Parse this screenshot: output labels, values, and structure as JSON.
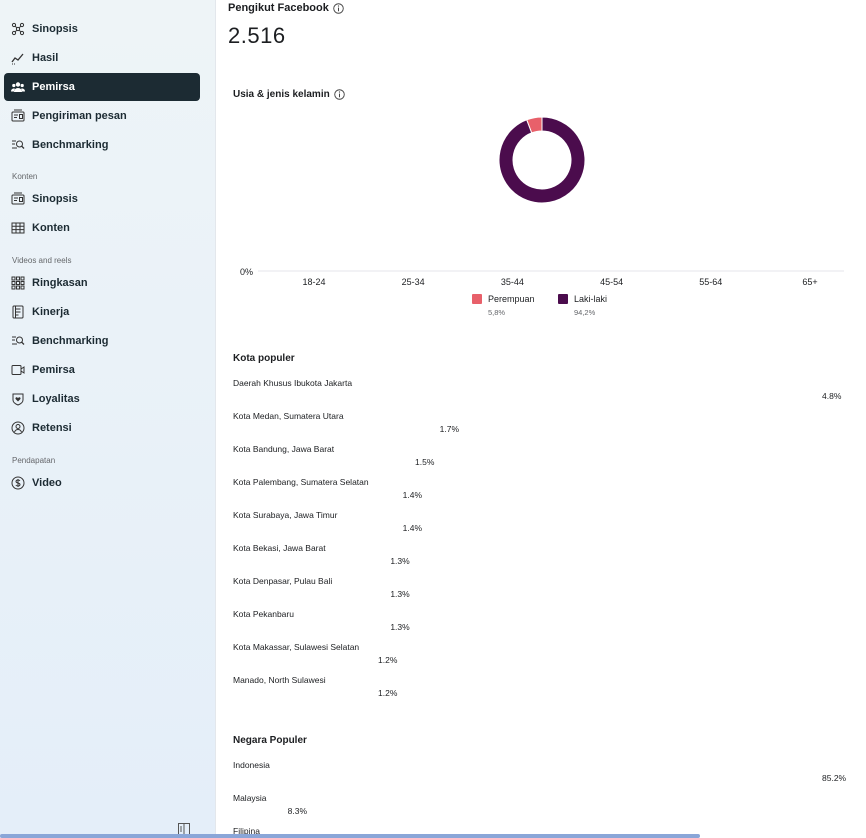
{
  "sidebar": {
    "items_top": [
      {
        "label": "Sinopsis",
        "icon": "network-icon"
      },
      {
        "label": "Hasil",
        "icon": "trend-icon"
      },
      {
        "label": "Pemirsa",
        "icon": "people-icon",
        "active": true
      },
      {
        "label": "Pengiriman pesan",
        "icon": "message-icon"
      },
      {
        "label": "Benchmarking",
        "icon": "search-list-icon"
      }
    ],
    "section_konten": "Konten",
    "items_konten": [
      {
        "label": "Sinopsis",
        "icon": "message-icon"
      },
      {
        "label": "Konten",
        "icon": "grid-icon"
      }
    ],
    "section_videos": "Videos and reels",
    "items_videos": [
      {
        "label": "Ringkasan",
        "icon": "dots-grid-icon"
      },
      {
        "label": "Kinerja",
        "icon": "document-icon"
      },
      {
        "label": "Benchmarking",
        "icon": "search-list-icon"
      },
      {
        "label": "Pemirsa",
        "icon": "video-icon"
      },
      {
        "label": "Loyalitas",
        "icon": "shield-heart-icon"
      },
      {
        "label": "Retensi",
        "icon": "person-circle-icon"
      }
    ],
    "section_pendapatan": "Pendapatan",
    "items_pendapatan": [
      {
        "label": "Video",
        "icon": "dollar-icon"
      }
    ]
  },
  "main": {
    "followers_title": "Pengikut Facebook",
    "followers_value": "2.516",
    "age_gender_title": "Usia & jenis kelamin",
    "kota_title": "Kota populer",
    "negara_title": "Negara Populer"
  },
  "chart_data": {
    "type": "pie",
    "donut": true,
    "slices": [
      {
        "label": "Perempuan",
        "value": 5.8,
        "pct_text": "5,8%",
        "color": "#e8606a"
      },
      {
        "label": "Laki-laki",
        "value": 94.2,
        "pct_text": "94,2%",
        "color": "#4b0c4d"
      }
    ],
    "age_axis": {
      "y_tick": "0%",
      "categories": [
        "18-24",
        "25-34",
        "35-44",
        "45-54",
        "55-64",
        "65+"
      ]
    }
  },
  "cities": [
    {
      "name": "Daerah Khusus Ibukota Jakarta",
      "value": 4.8,
      "text": "4.8%"
    },
    {
      "name": "Kota Medan, Sumatera Utara",
      "value": 1.7,
      "text": "1.7%"
    },
    {
      "name": "Kota Bandung, Jawa Barat",
      "value": 1.5,
      "text": "1.5%"
    },
    {
      "name": "Kota Palembang, Sumatera Selatan",
      "value": 1.4,
      "text": "1.4%"
    },
    {
      "name": "Kota Surabaya, Jawa Timur",
      "value": 1.4,
      "text": "1.4%"
    },
    {
      "name": "Kota Bekasi, Jawa Barat",
      "value": 1.3,
      "text": "1.3%"
    },
    {
      "name": "Kota Denpasar, Pulau Bali",
      "value": 1.3,
      "text": "1.3%"
    },
    {
      "name": "Kota Pekanbaru",
      "value": 1.3,
      "text": "1.3%"
    },
    {
      "name": "Kota Makassar, Sulawesi Selatan",
      "value": 1.2,
      "text": "1.2%"
    },
    {
      "name": "Manado, North Sulawesi",
      "value": 1.2,
      "text": "1.2%"
    }
  ],
  "countries": [
    {
      "name": "Indonesia",
      "value": 85.2,
      "text": "85.2%"
    },
    {
      "name": "Malaysia",
      "value": 8.3,
      "text": "8.3%"
    },
    {
      "name": "Filipina",
      "value": null,
      "text": ""
    }
  ]
}
